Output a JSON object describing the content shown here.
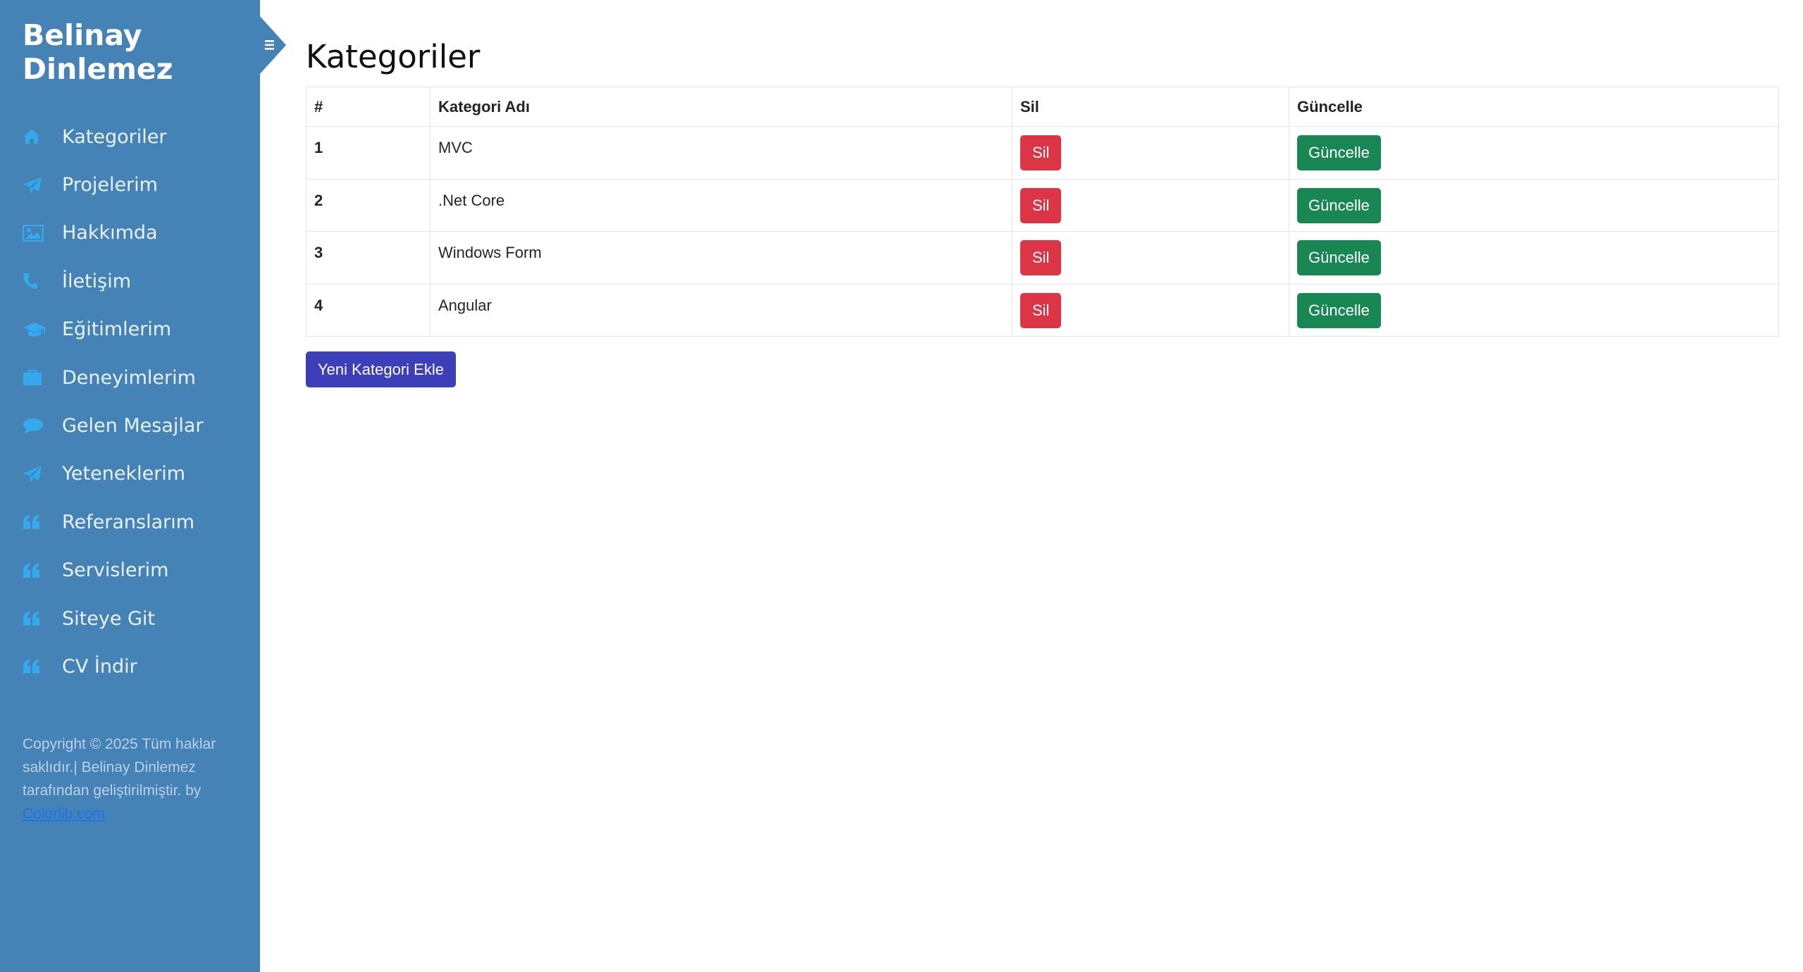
{
  "sidebar": {
    "brand_line1": "Belinay",
    "brand_line2": "Dinlemez",
    "items": [
      {
        "label": "Kategoriler",
        "icon": "home-icon"
      },
      {
        "label": "Projelerim",
        "icon": "paper-plane-icon"
      },
      {
        "label": "Hakkımda",
        "icon": "image-icon"
      },
      {
        "label": "İletişim",
        "icon": "phone-icon"
      },
      {
        "label": "Eğitimlerim",
        "icon": "graduation-cap-icon"
      },
      {
        "label": "Deneyimlerim",
        "icon": "briefcase-icon"
      },
      {
        "label": "Gelen Mesajlar",
        "icon": "comment-icon"
      },
      {
        "label": "Yeteneklerim",
        "icon": "paper-plane-icon"
      },
      {
        "label": "Referanslarım",
        "icon": "quote-icon"
      },
      {
        "label": "Servislerim",
        "icon": "quote-icon"
      },
      {
        "label": "Siteye Git",
        "icon": "quote-icon"
      },
      {
        "label": "CV İndir",
        "icon": "quote-icon"
      }
    ],
    "footer_text": "Copyright © 2025 Tüm haklar saklıdır.| Belinay Dinlemez tarafından geliştirilmiştir. by",
    "footer_link": "Colorlib.com"
  },
  "main": {
    "title": "Kategoriler",
    "table": {
      "headers": [
        "#",
        "Kategori Adı",
        "Sil",
        "Güncelle"
      ],
      "rows": [
        {
          "id": "1",
          "name": "MVC",
          "delete": "Sil",
          "update": "Güncelle"
        },
        {
          "id": "2",
          "name": ".Net Core",
          "delete": "Sil",
          "update": "Güncelle"
        },
        {
          "id": "3",
          "name": "Windows Form",
          "delete": "Sil",
          "update": "Güncelle"
        },
        {
          "id": "4",
          "name": "Angular",
          "delete": "Sil",
          "update": "Güncelle"
        }
      ]
    },
    "add_button": "Yeni Kategori Ekle"
  },
  "colors": {
    "sidebar_bg": "#4582b6",
    "icon_color": "#35a9ee",
    "danger": "#dc3545",
    "success": "#198754",
    "primary": "#3c3fb8"
  }
}
